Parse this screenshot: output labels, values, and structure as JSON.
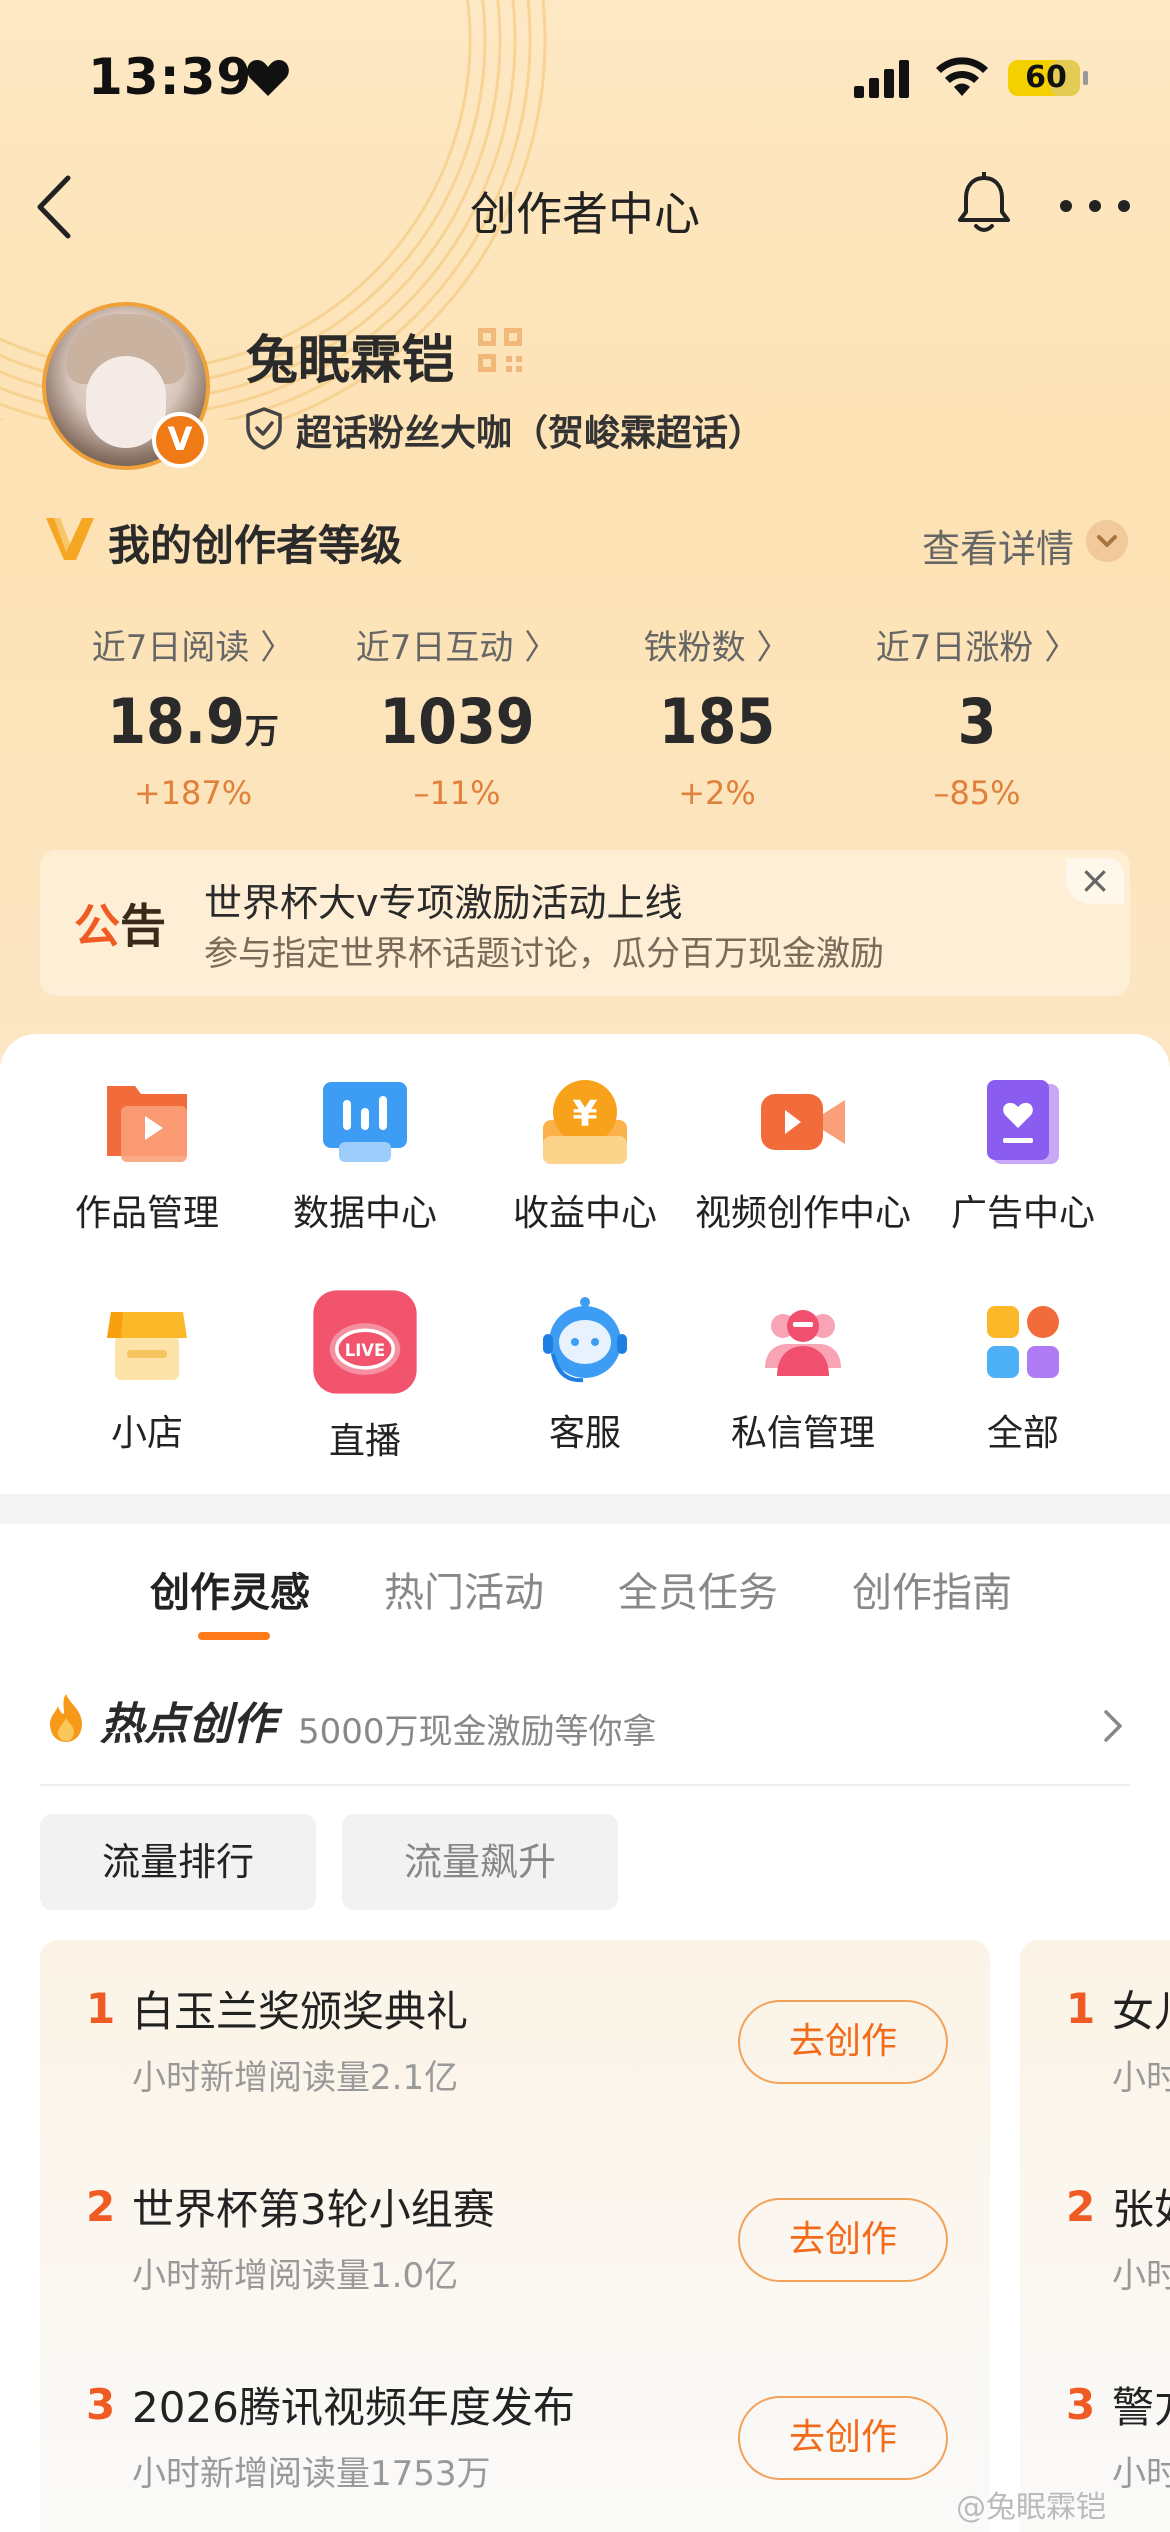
{
  "status_bar": {
    "time": "13:39",
    "battery": "60"
  },
  "nav": {
    "title": "创作者中心"
  },
  "profile": {
    "username": "兔眠霖铠",
    "vip_mark": "V",
    "badge": "超话粉丝大咖（贺峻霖超话）"
  },
  "level": {
    "title": "我的创作者等级",
    "detail_link": "查看详情"
  },
  "stats": [
    {
      "label": "近7日阅读 〉",
      "value": "18.9",
      "unit": "万",
      "change": "+187%"
    },
    {
      "label": "近7日互动 〉",
      "value": "1039",
      "unit": "",
      "change": "–11%"
    },
    {
      "label": "铁粉数 〉",
      "value": "185",
      "unit": "",
      "change": "+2%"
    },
    {
      "label": "近7日涨粉 〉",
      "value": "3",
      "unit": "",
      "change": "–85%"
    }
  ],
  "notice": {
    "tag_part1": "公",
    "tag_part2": "告",
    "title": "世界杯大v专项激励活动上线",
    "subtitle": "参与指定世界杯话题讨论，瓜分百万现金激励",
    "close": "×"
  },
  "tools": [
    {
      "label": "作品管理",
      "icon": "works-icon"
    },
    {
      "label": "数据中心",
      "icon": "data-icon"
    },
    {
      "label": "收益中心",
      "icon": "income-icon"
    },
    {
      "label": "视频创作中心",
      "icon": "video-icon"
    },
    {
      "label": "广告中心",
      "icon": "ad-icon"
    },
    {
      "label": "小店",
      "icon": "shop-icon"
    },
    {
      "label": "直播",
      "icon": "live-icon",
      "icon_text": "LIVE"
    },
    {
      "label": "客服",
      "icon": "service-icon"
    },
    {
      "label": "私信管理",
      "icon": "message-icon"
    },
    {
      "label": "全部",
      "icon": "all-icon"
    }
  ],
  "tabs": [
    "创作灵感",
    "热门活动",
    "全员任务",
    "创作指南"
  ],
  "hot": {
    "title": "热点创作",
    "subtitle": "5000万现金激励等你拿"
  },
  "filters": [
    "流量排行",
    "流量飙升"
  ],
  "ranking": [
    {
      "num": "1",
      "title": "白玉兰奖颁奖典礼",
      "sub": "小时新增阅读量2.1亿",
      "button": "去创作"
    },
    {
      "num": "2",
      "title": "世界杯第3轮小组赛",
      "sub": "小时新增阅读量1.0亿",
      "button": "去创作"
    },
    {
      "num": "3",
      "title": "2026腾讯视频年度发布",
      "sub": "小时新增阅读量1753万",
      "button": "去创作"
    }
  ],
  "ranking_peek": [
    {
      "num": "1",
      "title": "女儿",
      "sub": "小时"
    },
    {
      "num": "2",
      "title": "张如",
      "sub": "小时"
    },
    {
      "num": "3",
      "title": "警方",
      "sub": "小时"
    }
  ],
  "watermark": "@兔眠霖铠",
  "colors": {
    "accent": "#ff7a1a",
    "rank_number": "#f05a23",
    "change_text": "#e0803a",
    "header_bg": "#fde2b4"
  }
}
